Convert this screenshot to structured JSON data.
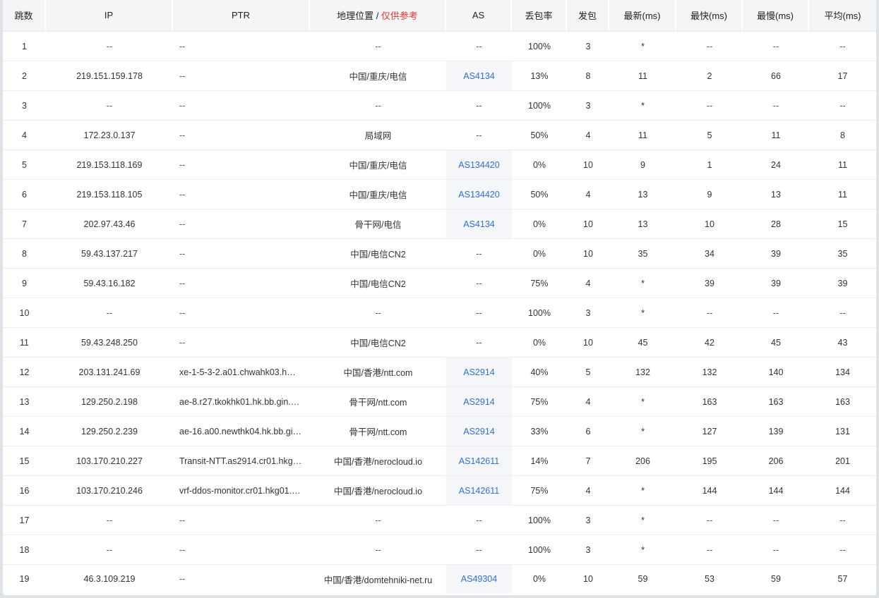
{
  "headers": {
    "hop": "跳数",
    "ip": "IP",
    "ptr": "PTR",
    "geo_main": "地理位置",
    "geo_sep": " / ",
    "geo_warn": "仅供参考",
    "as": "AS",
    "loss": "丢包率",
    "sent": "发包",
    "last": "最新(ms)",
    "best": "最快(ms)",
    "worst": "最慢(ms)",
    "avg": "平均(ms)"
  },
  "colors": {
    "as_link": "#2f6fd6",
    "warn": "#e5392f"
  },
  "rows": [
    {
      "hop": "1",
      "ip": "--",
      "ptr": "--",
      "geo": "--",
      "as": "--",
      "loss": "100%",
      "sent": "3",
      "last": "*",
      "best": "--",
      "worst": "--",
      "avg": "--"
    },
    {
      "hop": "2",
      "ip": "219.151.159.178",
      "ptr": "--",
      "geo": "中国/重庆/电信",
      "as": "AS4134",
      "loss": "13%",
      "sent": "8",
      "last": "11",
      "best": "2",
      "worst": "66",
      "avg": "17"
    },
    {
      "hop": "3",
      "ip": "--",
      "ptr": "--",
      "geo": "--",
      "as": "--",
      "loss": "100%",
      "sent": "3",
      "last": "*",
      "best": "--",
      "worst": "--",
      "avg": "--"
    },
    {
      "hop": "4",
      "ip": "172.23.0.137",
      "ptr": "--",
      "geo": "局域网",
      "as": "--",
      "loss": "50%",
      "sent": "4",
      "last": "11",
      "best": "5",
      "worst": "11",
      "avg": "8"
    },
    {
      "hop": "5",
      "ip": "219.153.118.169",
      "ptr": "--",
      "geo": "中国/重庆/电信",
      "as": "AS134420",
      "loss": "0%",
      "sent": "10",
      "last": "9",
      "best": "1",
      "worst": "24",
      "avg": "11"
    },
    {
      "hop": "6",
      "ip": "219.153.118.105",
      "ptr": "--",
      "geo": "中国/重庆/电信",
      "as": "AS134420",
      "loss": "50%",
      "sent": "4",
      "last": "13",
      "best": "9",
      "worst": "13",
      "avg": "11"
    },
    {
      "hop": "7",
      "ip": "202.97.43.46",
      "ptr": "--",
      "geo": "骨干网/电信",
      "as": "AS4134",
      "loss": "0%",
      "sent": "10",
      "last": "13",
      "best": "10",
      "worst": "28",
      "avg": "15"
    },
    {
      "hop": "8",
      "ip": "59.43.137.217",
      "ptr": "--",
      "geo": "中国/电信CN2",
      "as": "--",
      "loss": "0%",
      "sent": "10",
      "last": "35",
      "best": "34",
      "worst": "39",
      "avg": "35"
    },
    {
      "hop": "9",
      "ip": "59.43.16.182",
      "ptr": "--",
      "geo": "中国/电信CN2",
      "as": "--",
      "loss": "75%",
      "sent": "4",
      "last": "*",
      "best": "39",
      "worst": "39",
      "avg": "39"
    },
    {
      "hop": "10",
      "ip": "--",
      "ptr": "--",
      "geo": "--",
      "as": "--",
      "loss": "100%",
      "sent": "3",
      "last": "*",
      "best": "--",
      "worst": "--",
      "avg": "--"
    },
    {
      "hop": "11",
      "ip": "59.43.248.250",
      "ptr": "--",
      "geo": "中国/电信CN2",
      "as": "--",
      "loss": "0%",
      "sent": "10",
      "last": "45",
      "best": "42",
      "worst": "45",
      "avg": "43"
    },
    {
      "hop": "12",
      "ip": "203.131.241.69",
      "ptr": "xe-1-5-3-2.a01.chwahk03.h…",
      "geo": "中国/香港/ntt.com",
      "as": "AS2914",
      "loss": "40%",
      "sent": "5",
      "last": "132",
      "best": "132",
      "worst": "140",
      "avg": "134"
    },
    {
      "hop": "13",
      "ip": "129.250.2.198",
      "ptr": "ae-8.r27.tkokhk01.hk.bb.gin.…",
      "geo": "骨干网/ntt.com",
      "as": "AS2914",
      "loss": "75%",
      "sent": "4",
      "last": "*",
      "best": "163",
      "worst": "163",
      "avg": "163"
    },
    {
      "hop": "14",
      "ip": "129.250.2.239",
      "ptr": "ae-16.a00.newthk04.hk.bb.gi…",
      "geo": "骨干网/ntt.com",
      "as": "AS2914",
      "loss": "33%",
      "sent": "6",
      "last": "*",
      "best": "127",
      "worst": "139",
      "avg": "131"
    },
    {
      "hop": "15",
      "ip": "103.170.210.227",
      "ptr": "Transit-NTT.as2914.cr01.hkg…",
      "geo": "中国/香港/nerocloud.io",
      "as": "AS142611",
      "loss": "14%",
      "sent": "7",
      "last": "206",
      "best": "195",
      "worst": "206",
      "avg": "201"
    },
    {
      "hop": "16",
      "ip": "103.170.210.246",
      "ptr": "vrf-ddos-monitor.cr01.hkg01.…",
      "geo": "中国/香港/nerocloud.io",
      "as": "AS142611",
      "loss": "75%",
      "sent": "4",
      "last": "*",
      "best": "144",
      "worst": "144",
      "avg": "144"
    },
    {
      "hop": "17",
      "ip": "--",
      "ptr": "--",
      "geo": "--",
      "as": "--",
      "loss": "100%",
      "sent": "3",
      "last": "*",
      "best": "--",
      "worst": "--",
      "avg": "--"
    },
    {
      "hop": "18",
      "ip": "--",
      "ptr": "--",
      "geo": "--",
      "as": "--",
      "loss": "100%",
      "sent": "3",
      "last": "*",
      "best": "--",
      "worst": "--",
      "avg": "--"
    },
    {
      "hop": "19",
      "ip": "46.3.109.219",
      "ptr": "--",
      "geo": "中国/香港/domtehniki-net.ru",
      "as": "AS49304",
      "loss": "0%",
      "sent": "10",
      "last": "59",
      "best": "53",
      "worst": "59",
      "avg": "57"
    }
  ]
}
